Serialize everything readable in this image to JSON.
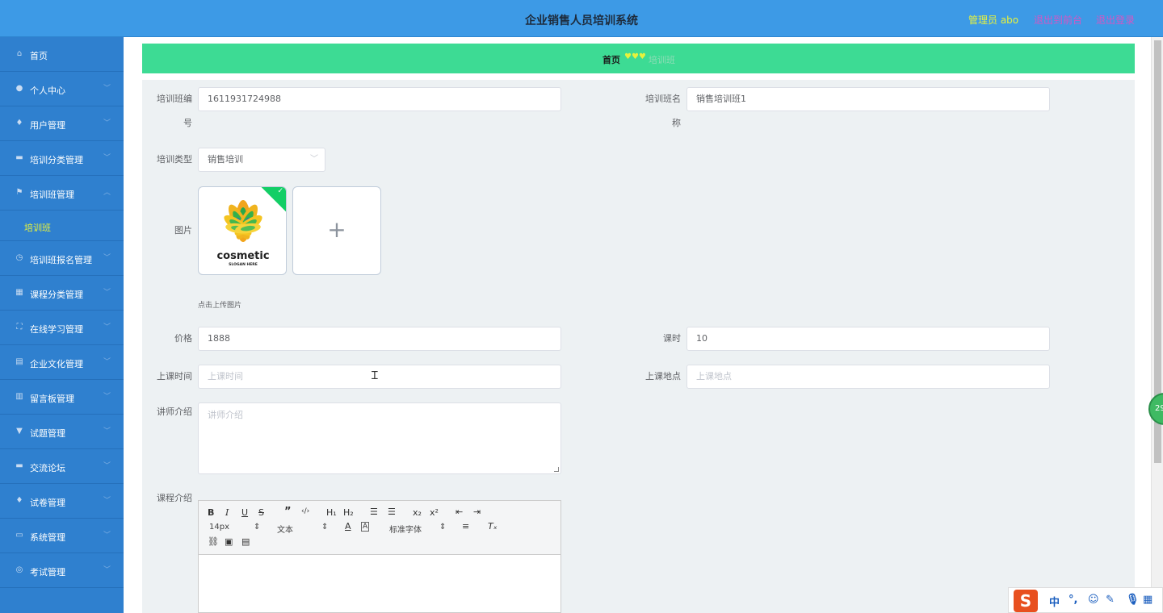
{
  "header": {
    "title": "企业销售人员培训系统",
    "admin": "管理员 abo",
    "front": "退出到前台",
    "logout": "退出登录"
  },
  "sidebar": {
    "items": [
      {
        "label": "首页",
        "icon": "home-icon"
      },
      {
        "label": "个人中心",
        "icon": "user-icon"
      },
      {
        "label": "用户管理",
        "icon": "mic-icon"
      },
      {
        "label": "培训分类管理",
        "icon": "briefcase-icon"
      },
      {
        "label": "培训班管理",
        "icon": "flag-icon"
      },
      {
        "label": "培训班报名管理",
        "icon": "clock-icon"
      },
      {
        "label": "课程分类管理",
        "icon": "grid-icon"
      },
      {
        "label": "在线学习管理",
        "icon": "fullscreen-icon"
      },
      {
        "label": "企业文化管理",
        "icon": "clipboard-icon"
      },
      {
        "label": "留言板管理",
        "icon": "bar-chart-icon"
      },
      {
        "label": "试题管理",
        "icon": "tag-icon"
      },
      {
        "label": "交流论坛",
        "icon": "comments-icon"
      },
      {
        "label": "试卷管理",
        "icon": "bulb-icon"
      },
      {
        "label": "系统管理",
        "icon": "monitor-icon"
      },
      {
        "label": "考试管理",
        "icon": "globe-icon"
      }
    ],
    "submenu_label": "培训班"
  },
  "breadcrumb": {
    "home": "首页",
    "current": "培训班"
  },
  "form": {
    "class_no_label_1": "培训班编",
    "class_no_label_2": "号",
    "class_no_value": "1611931724988",
    "class_name_label_1": "培训班名",
    "class_name_label_2": "称",
    "class_name_value": "销售培训班1",
    "type_label": "培训类型",
    "type_value": "销售培训",
    "image_label": "图片",
    "image_text": "cosmetic",
    "image_subtext": "SLOGAN HERE",
    "upload_hint": "点击上传图片",
    "price_label": "价格",
    "price_value": "1888",
    "hours_label": "课时",
    "hours_value": "10",
    "time_label": "上课时间",
    "time_placeholder": "上课时间",
    "place_label": "上课地点",
    "place_placeholder": "上课地点",
    "teacher_label": "讲师介绍",
    "teacher_placeholder": "讲师介绍",
    "course_label": "课程介绍"
  },
  "editor": {
    "font_size": "14px",
    "paragraph": "文本",
    "font_family": "标准字体"
  },
  "float_ball": "29",
  "ime": {
    "logo": "S",
    "lang": "中"
  }
}
